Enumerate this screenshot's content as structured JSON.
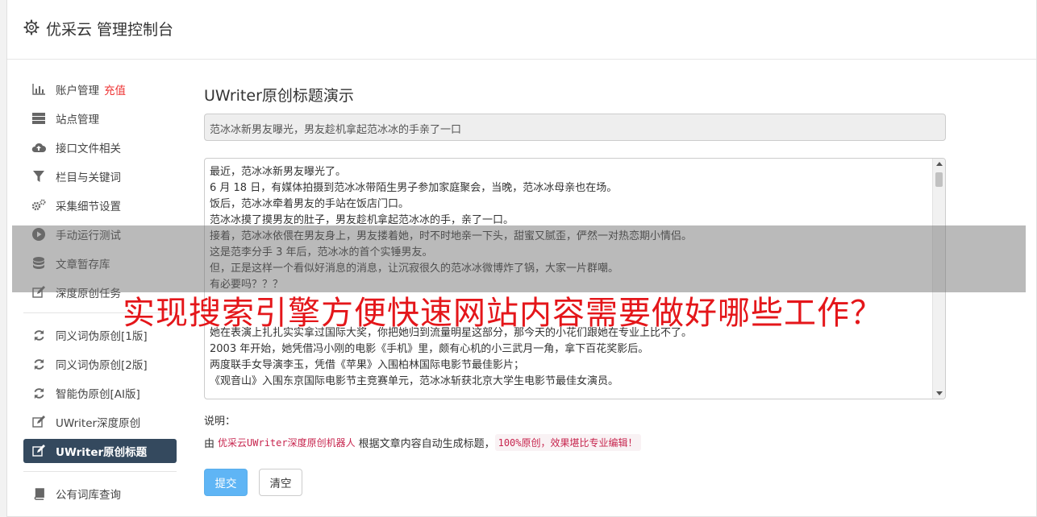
{
  "header": {
    "title": "优采云 管理控制台"
  },
  "sidebar": {
    "recharge": "充值",
    "items": [
      {
        "label": "账户管理",
        "icon": "bar-chart-icon"
      },
      {
        "label": "站点管理",
        "icon": "server-icon"
      },
      {
        "label": "接口文件相关",
        "icon": "cloud-upload-icon"
      },
      {
        "label": "栏目与关键词",
        "icon": "filter-icon"
      },
      {
        "label": "采集细节设置",
        "icon": "cogs-icon"
      },
      {
        "label": "手动运行测试",
        "icon": "play-icon"
      },
      {
        "label": "文章暂存库",
        "icon": "database-icon"
      },
      {
        "label": "深度原创任务",
        "icon": "edit-icon"
      },
      {
        "label": "同义词伪原创[1版]",
        "icon": "refresh-icon"
      },
      {
        "label": "同义词伪原创[2版]",
        "icon": "refresh-icon"
      },
      {
        "label": "智能伪原创[AI版]",
        "icon": "refresh-icon"
      },
      {
        "label": "UWriter深度原创",
        "icon": "edit-icon"
      },
      {
        "label": "UWriter原创标题",
        "icon": "edit-icon"
      },
      {
        "label": "公有词库查询",
        "icon": "book-icon"
      }
    ]
  },
  "main": {
    "page_title": "UWriter原创标题演示",
    "title_value": "范冰冰新男友曝光，男友趁机拿起范冰冰的手亲了一口",
    "content_lines": [
      "最近，范冰冰新男友曝光了。",
      "6 月 18 日，有媒体拍摄到范冰冰带陌生男子参加家庭聚会，当晚，范冰冰母亲也在场。",
      "饭后，范冰冰牵着男友的手站在饭店门口。",
      "范冰冰摸了摸男友的肚子，男友趁机拿起范冰冰的手，亲了一口。",
      "接着，范冰冰依偎在男友身上，男友搂着她，时不时地亲一下头，甜蜜又腻歪，俨然一对热恋期小情侣。",
      "这是范李分手 3 年后，范冰冰的首个实锤男友。",
      "但，正是这样一个看似好消息的消息，让沉寂很久的范冰冰微博炸了锅，大家一片群嘲。",
      "有必要吗？？？",
      "",
      "",
      "她在表演上扎扎实实拿过国际大奖，你把她归到流量明星这部分，那今天的小花们跟她在专业上比不了。",
      "2003 年开始，她凭借冯小刚的电影《手机》里，颇有心机的小三武月一角，拿下百花奖影后。",
      "两度联手女导演李玉，凭借《苹果》入围柏林国际电影节最佳影片；",
      "《观音山》入围东京国际电影节主竞赛单元，范冰冰斩获北京大学生电影节最佳女演员。"
    ],
    "note_label": "说明：",
    "note_prefix": "由",
    "note_robot": "优采云UWriter深度原创机器人",
    "note_middle": "根据文章内容自动生成标题，",
    "note_badge": "100%原创，效果堪比专业编辑！",
    "submit_label": "提交",
    "clear_label": "清空"
  },
  "overlay": {
    "title": "实现搜索引擎方便快速网站内容需要做好哪些工作？"
  },
  "colors": {
    "accent": "#5fb5f5",
    "sidebar_active": "#34495e",
    "overlay_text": "#e4161a",
    "recharge": "#e33333"
  }
}
